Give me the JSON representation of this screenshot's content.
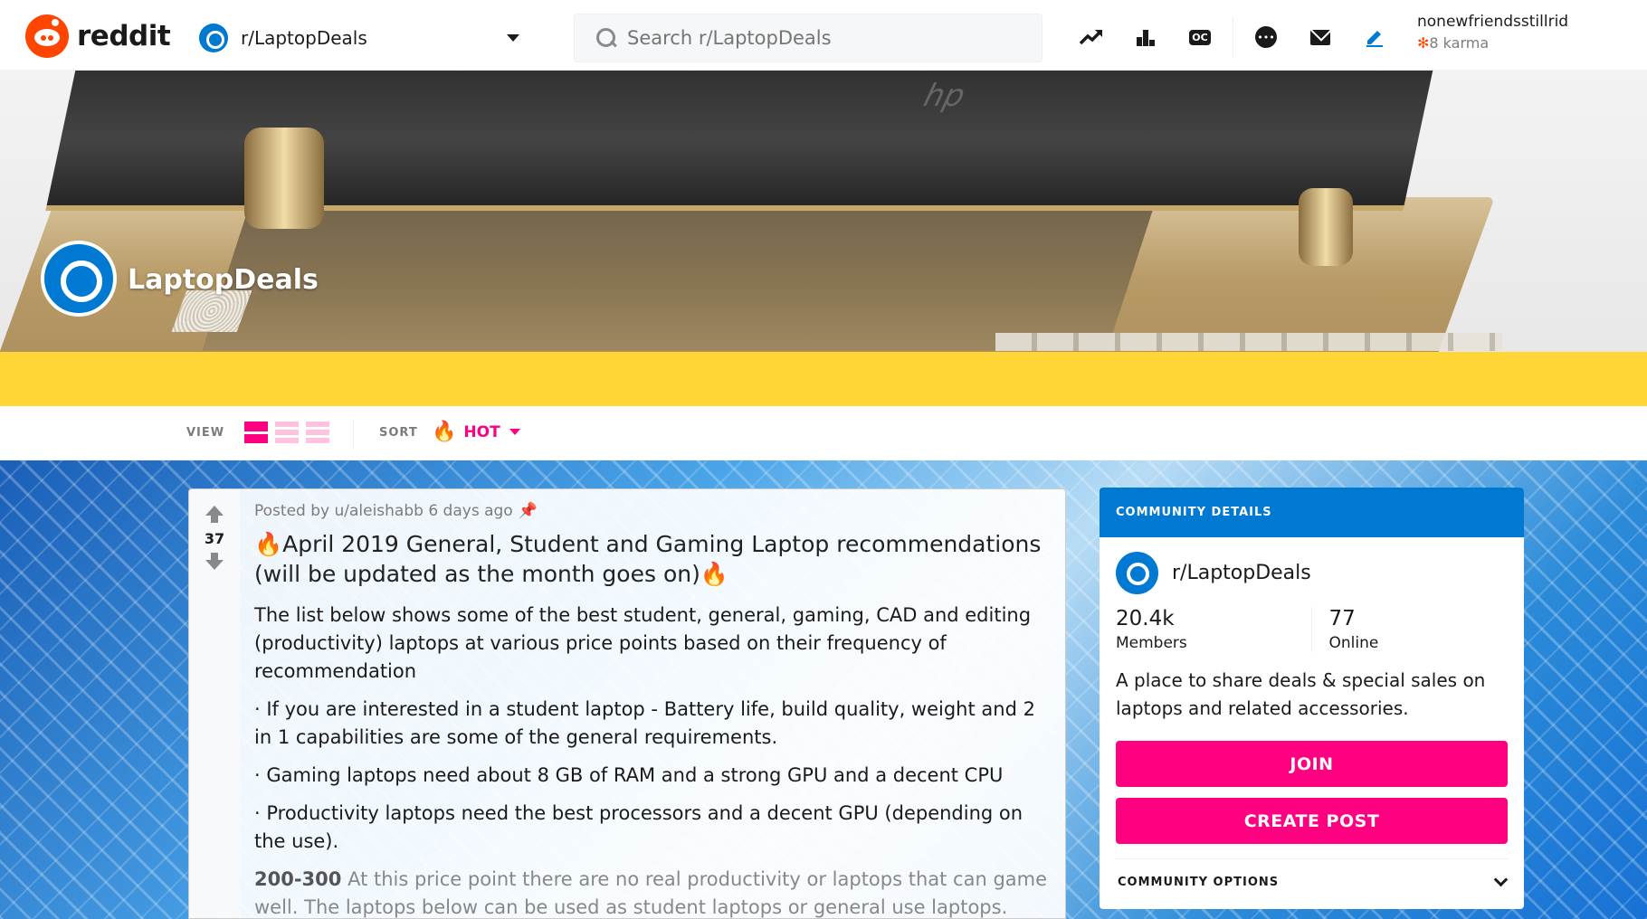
{
  "header": {
    "logo_text": "reddit",
    "subreddit": "r/LaptopDeals",
    "search_placeholder": "Search r/LaptopDeals",
    "user": {
      "name": "nonewfriendsstillrid",
      "karma": "8 karma"
    },
    "icons": [
      "trending-icon",
      "leaderboard-icon",
      "oc-icon",
      "chat-icon",
      "mail-icon",
      "create-post-icon"
    ]
  },
  "banner": {
    "community_title": "LaptopDeals"
  },
  "sortbar": {
    "view_label": "VIEW",
    "sort_label": "SORT",
    "sort_value": "HOT"
  },
  "post": {
    "score": "37",
    "meta": "Posted by u/aleishabb 6 days ago",
    "title": "🔥April 2019 General, Student and Gaming Laptop recommendations (will be updated as the month goes on)🔥",
    "paragraphs": [
      "The list below shows some of the best student, general, gaming, CAD and editing (productivity) laptops at various price points based on their frequency of recommendation",
      "· If you are interested in a student laptop - Battery life, build quality, weight and 2 in 1 capabilities are some of the general requirements.",
      "· Gaming laptops need about 8 GB of RAM and a strong GPU and a decent CPU",
      "· Productivity laptops need the best processors and a decent GPU (depending on the use)."
    ],
    "price_label": "200-300",
    "price_text": " At this price point there are no real productivity or laptops that can game well. The laptops below can be used as student laptops or general use laptops. However you can get more powerful refurbished laptops if you prefer that route"
  },
  "sidebar": {
    "header": "COMMUNITY DETAILS",
    "name": "r/LaptopDeals",
    "members_count": "20.4k",
    "members_label": "Members",
    "online_count": "77",
    "online_label": "Online",
    "description": "A place to share deals & special sales on laptops and related accessories.",
    "join_label": "JOIN",
    "create_post_label": "CREATE POST",
    "options_label": "COMMUNITY OPTIONS"
  },
  "colors": {
    "brand": "#ff4500",
    "accent_pink": "#ff0080",
    "blue": "#0079d3",
    "yellow": "#ffd635"
  }
}
